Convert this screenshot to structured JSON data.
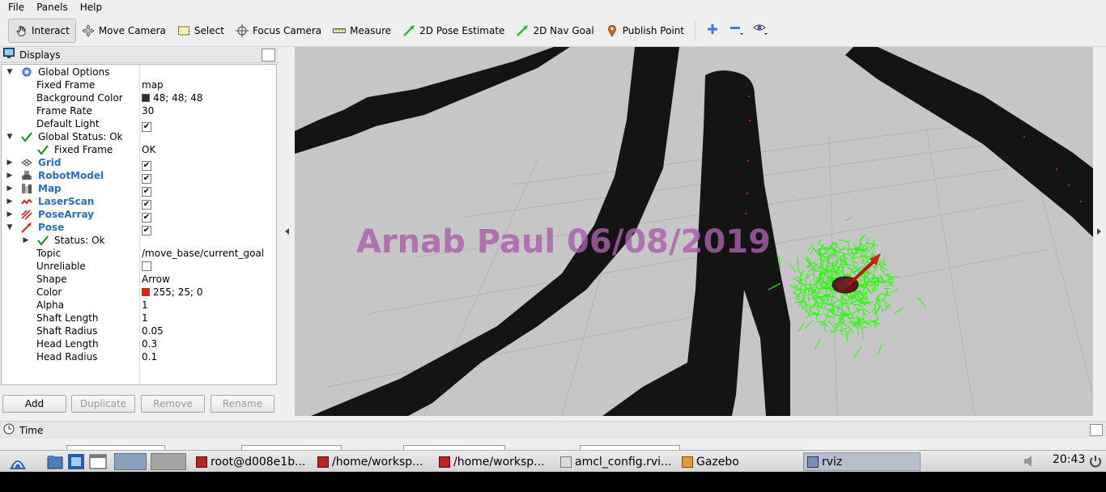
{
  "menu": [
    "File",
    "Panels",
    "Help"
  ],
  "toolbar": {
    "interact": "Interact",
    "move_camera": "Move Camera",
    "select": "Select",
    "focus_camera": "Focus Camera",
    "measure": "Measure",
    "pose_estimate": "2D Pose Estimate",
    "nav_goal": "2D Nav Goal",
    "publish_point": "Publish Point"
  },
  "displays": {
    "title": "Displays",
    "rows": [
      {
        "label": "Global Options",
        "value": ""
      },
      {
        "label": "Fixed Frame",
        "value": "map"
      },
      {
        "label": "Background Color",
        "value": "48; 48; 48",
        "swatch": "#303030"
      },
      {
        "label": "Frame Rate",
        "value": "30"
      },
      {
        "label": "Default Light",
        "value": ""
      },
      {
        "label": "Global Status: Ok",
        "value": ""
      },
      {
        "label": "Fixed Frame",
        "value": "OK"
      },
      {
        "label": "Grid",
        "value": ""
      },
      {
        "label": "RobotModel",
        "value": ""
      },
      {
        "label": "Map",
        "value": ""
      },
      {
        "label": "LaserScan",
        "value": ""
      },
      {
        "label": "PoseArray",
        "value": ""
      },
      {
        "label": "Pose",
        "value": ""
      },
      {
        "label": "Status: Ok",
        "value": ""
      },
      {
        "label": "Topic",
        "value": "/move_base/current_goal"
      },
      {
        "label": "Unreliable",
        "value": ""
      },
      {
        "label": "Shape",
        "value": "Arrow"
      },
      {
        "label": "Color",
        "value": "255; 25; 0",
        "swatch": "#ff1900"
      },
      {
        "label": "Alpha",
        "value": "1"
      },
      {
        "label": "Shaft Length",
        "value": "1"
      },
      {
        "label": "Shaft Radius",
        "value": "0.05"
      },
      {
        "label": "Head Length",
        "value": "0.3"
      },
      {
        "label": "Head Radius",
        "value": "0.1"
      }
    ],
    "buttons": {
      "add": "Add",
      "duplicate": "Duplicate",
      "remove": "Remove",
      "rename": "Rename"
    }
  },
  "view": {
    "watermark": "Arnab Paul 06/08/2019"
  },
  "time_panel": {
    "title": "Time"
  },
  "taskbar": {
    "items": [
      "root@d008e1b...",
      "/home/worksp...",
      "/home/worksp...",
      "amcl_config.rvi...",
      "Gazebo",
      "rviz"
    ],
    "clock": "20:43"
  },
  "colors": {
    "accent": "#2a6ebb",
    "wall": "#141414",
    "floor": "#c6c6c6",
    "particles": "#22ff00",
    "goal_arrow": "#ff1900"
  }
}
